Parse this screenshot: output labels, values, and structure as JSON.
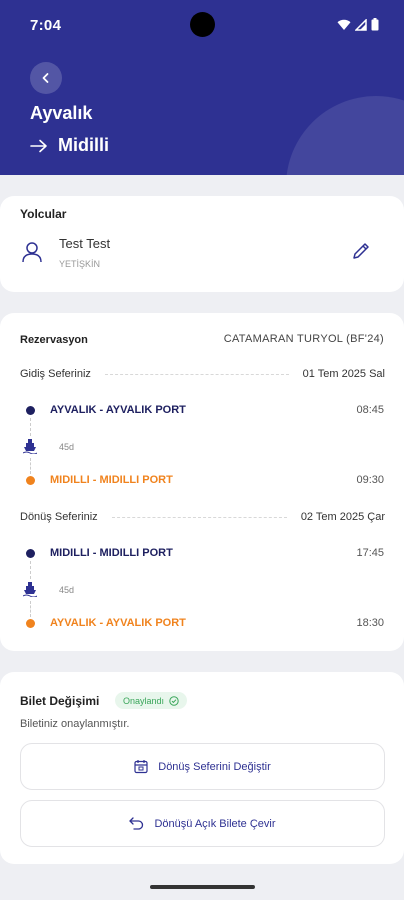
{
  "status": {
    "time": "7:04"
  },
  "header": {
    "origin": "Ayvalık",
    "destination": "Midilli"
  },
  "passengers": {
    "title": "Yolcular",
    "name": "Test Test",
    "type": "YETİŞKİN"
  },
  "reservation": {
    "label": "Rezervasyon",
    "value": "CATAMARAN TURYOL (BF'24)",
    "outbound": {
      "label": "Gidiş Seferiniz",
      "date": "01 Tem 2025 Sal",
      "from": "AYVALIK - AYVALIK PORT",
      "from_time": "08:45",
      "duration": "45d",
      "to": "MIDILLI - MIDILLI PORT",
      "to_time": "09:30"
    },
    "return": {
      "label": "Dönüş Seferiniz",
      "date": "02 Tem 2025 Çar",
      "from": "MIDILLI - MIDILLI PORT",
      "from_time": "17:45",
      "duration": "45d",
      "to": "AYVALIK - AYVALIK PORT",
      "to_time": "18:30"
    }
  },
  "ticket_change": {
    "title": "Bilet Değişimi",
    "badge": "Onaylandı",
    "message": "Biletiniz onaylanmıştır.",
    "change_return_label": "Dönüş Seferini Değiştir",
    "open_ticket_label": "Dönüşü Açık Bilete Çevir"
  },
  "colors": {
    "primary": "#2e3192",
    "accent": "#f0831e",
    "navy_dot": "#1e2060",
    "success": "#3aa65a"
  }
}
